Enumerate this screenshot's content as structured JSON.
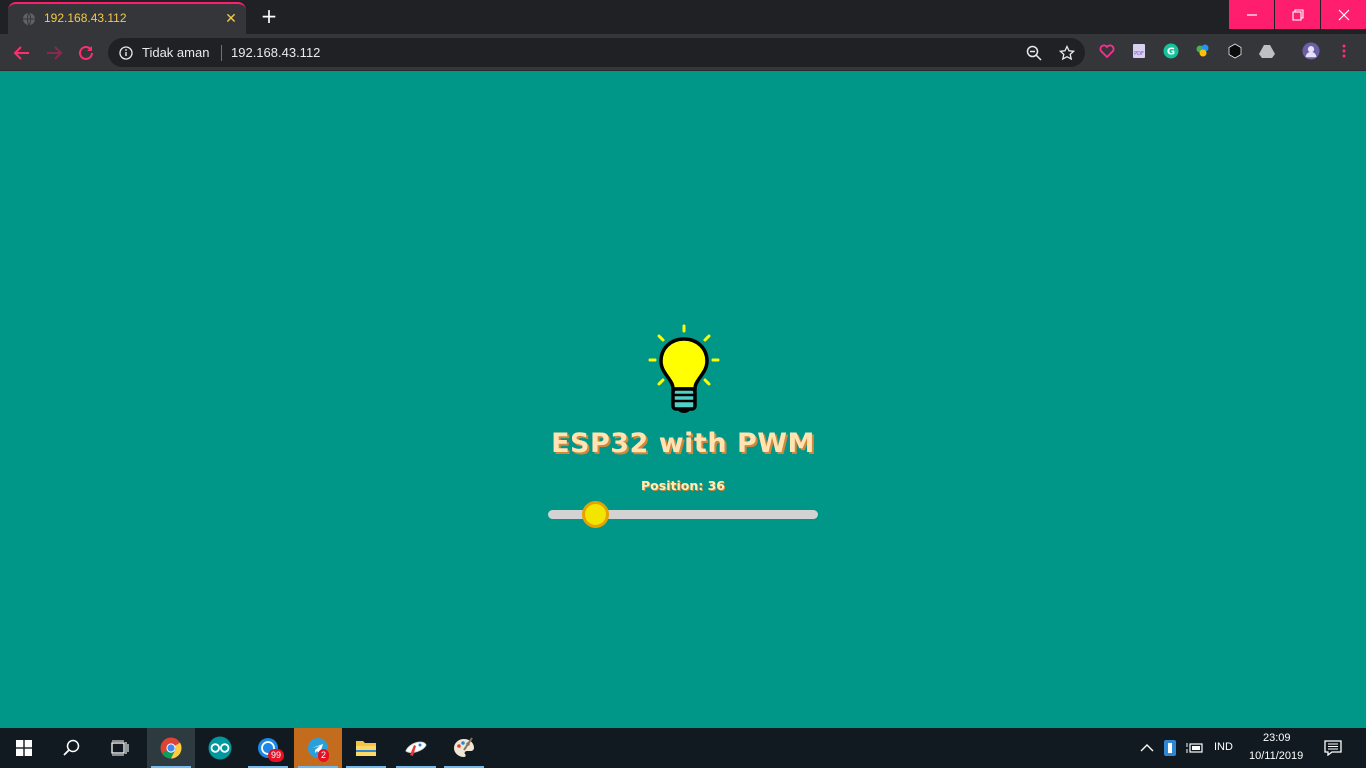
{
  "browser": {
    "tab": {
      "title": "192.168.43.112",
      "close_label": "✕"
    },
    "new_tab_label": "+",
    "window": {
      "minimize_label": "—",
      "restore_label": "❐",
      "close_label": "✕"
    },
    "omnibox": {
      "security_label": "Tidak aman",
      "url": "192.168.43.112"
    },
    "extensions": [
      "heart-icon",
      "pdf-icon",
      "grammarly-icon",
      "colorful-extension-icon",
      "cube-icon",
      "drive-icon"
    ]
  },
  "page": {
    "heading": "ESP32 with PWM",
    "position_label": "Position: 36",
    "slider": {
      "value": 36,
      "min": 0,
      "max": 180
    },
    "colors": {
      "background": "#009688",
      "heading": "#ffe3b3",
      "heading_shadow": "#d2883a",
      "bulb": "#ffff00",
      "thumb": "#f2e600",
      "thumb_border": "#e6a200"
    }
  },
  "taskbar": {
    "apps": [
      "windows-start",
      "search",
      "task-view",
      "chrome",
      "arduino",
      "messenger",
      "telegram",
      "file-explorer",
      "paint-3d",
      "paint"
    ],
    "messenger_badge": "99",
    "telegram_badge": "2",
    "tray": {
      "language": "IND",
      "time": "23:09",
      "date": "10/11/2019"
    }
  }
}
